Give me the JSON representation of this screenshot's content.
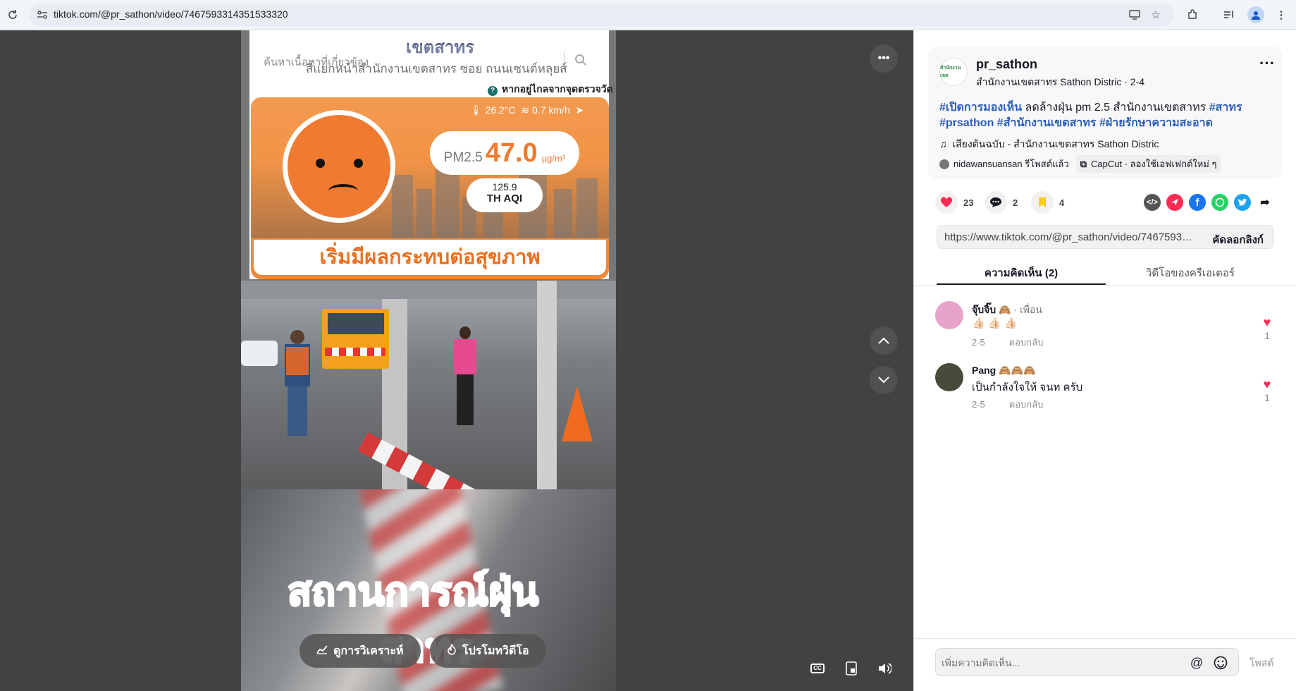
{
  "browser": {
    "url": "tiktok.com/@pr_sathon/video/7467593314351533320",
    "icons": [
      "reload-icon",
      "site-info-icon",
      "install-app-icon",
      "bookmark-star-icon",
      "extensions-icon",
      "media-controls-icon",
      "profile-icon",
      "menu-dots-icon"
    ]
  },
  "video_overlay": {
    "search_placeholder": "ค้นหาเนื้อหาที่เกี่ยวข้อง",
    "aqi": {
      "org_logo": "เขตสาทร",
      "location": "สี่แยกหน้าสำนักงานเขตสาทร ซอย ถนนเซนต์หลุยส์",
      "distance_note": "หากอยู่ไกลจากจุดตรวจวัด",
      "temperature": "26.2°C",
      "wind": "0.7 km/h",
      "pm_label": "PM2.5",
      "pm_value": "47.0",
      "pm_unit": "µg/m³",
      "aqi_value": "125.9",
      "aqi_label": "TH AQI",
      "status": "เริ่มมีผลกระทบต่อสุขภาพ"
    },
    "caption_line1": "สถานการณ์ฝุ่น",
    "caption_line2": "สาทร",
    "analytics_button": "ดูการวิเคราะห์",
    "promote_button": "โปรโมทวิดีโอ"
  },
  "post": {
    "avatar_text": "สำนักงานเขต",
    "username": "pr_sathon",
    "nickname_date": "สำนักงานเขตสาทร Sathon Distric · 2-4",
    "description": [
      {
        "text": "#เปิดการมองเห็น",
        "tag": true
      },
      {
        "text": " ลดล้างฝุ่น pm 2.5 สำนักงานเขตสาทร ",
        "tag": false
      },
      {
        "text": "#สาทร",
        "tag": true
      },
      {
        "text": " ",
        "tag": false
      },
      {
        "text": "#prsathon",
        "tag": true
      },
      {
        "text": " ",
        "tag": false
      },
      {
        "text": "#สำนักงานเขตสาทร",
        "tag": true
      },
      {
        "text": " ",
        "tag": false
      },
      {
        "text": "#ฝ่ายรักษาความสะอาด",
        "tag": true
      }
    ],
    "music": "เสียงต้นฉบับ - สำนักงานเขตสาทร Sathon Distric",
    "repost": "nidawansuansan รีโพสต์แล้ว",
    "capcut": "CapCut · ลองใช้เอฟเฟกต์ใหม่ ๆ"
  },
  "actions": {
    "likes": "23",
    "comments": "2",
    "saves": "4",
    "share_icons": [
      "embed-icon",
      "send-icon",
      "facebook-icon",
      "whatsapp-icon",
      "twitter-icon",
      "share-arrow-icon"
    ],
    "colors": {
      "heart": "#fe2c55",
      "bookmark": "#face15",
      "facebook": "#1877f2",
      "whatsapp": "#25d366",
      "twitter": "#1da1f2",
      "send": "#fe2c55",
      "embed": "#555555"
    }
  },
  "link": {
    "url": "https://www.tiktok.com/@pr_sathon/video/7467593314351533320",
    "copy_label": "คัดลอกลิงก์"
  },
  "tabs": [
    {
      "label": "ความคิดเห็น (2)",
      "active": true
    },
    {
      "label": "วิดีโอของครีเอเตอร์",
      "active": false
    }
  ],
  "comments": [
    {
      "name": "จุ๊บจิ๊บ 🙈",
      "friend": " · เพื่อน",
      "text": "👍🏻 👍🏻 👍🏻",
      "date": "2-5",
      "reply": "ตอบกลับ",
      "likes": "1",
      "avatar_color": "#e7a3c9"
    },
    {
      "name": "Pang 🙈🙈🙈",
      "friend": "",
      "text": "เป็นกำลังใจให้ จนท ครับ",
      "date": "2-5",
      "reply": "ตอบกลับ",
      "likes": "1",
      "avatar_color": "#4a4a3a"
    }
  ],
  "footer": {
    "placeholder": "เพิ่มความคิดเห็น...",
    "post_label": "โพสต์"
  }
}
